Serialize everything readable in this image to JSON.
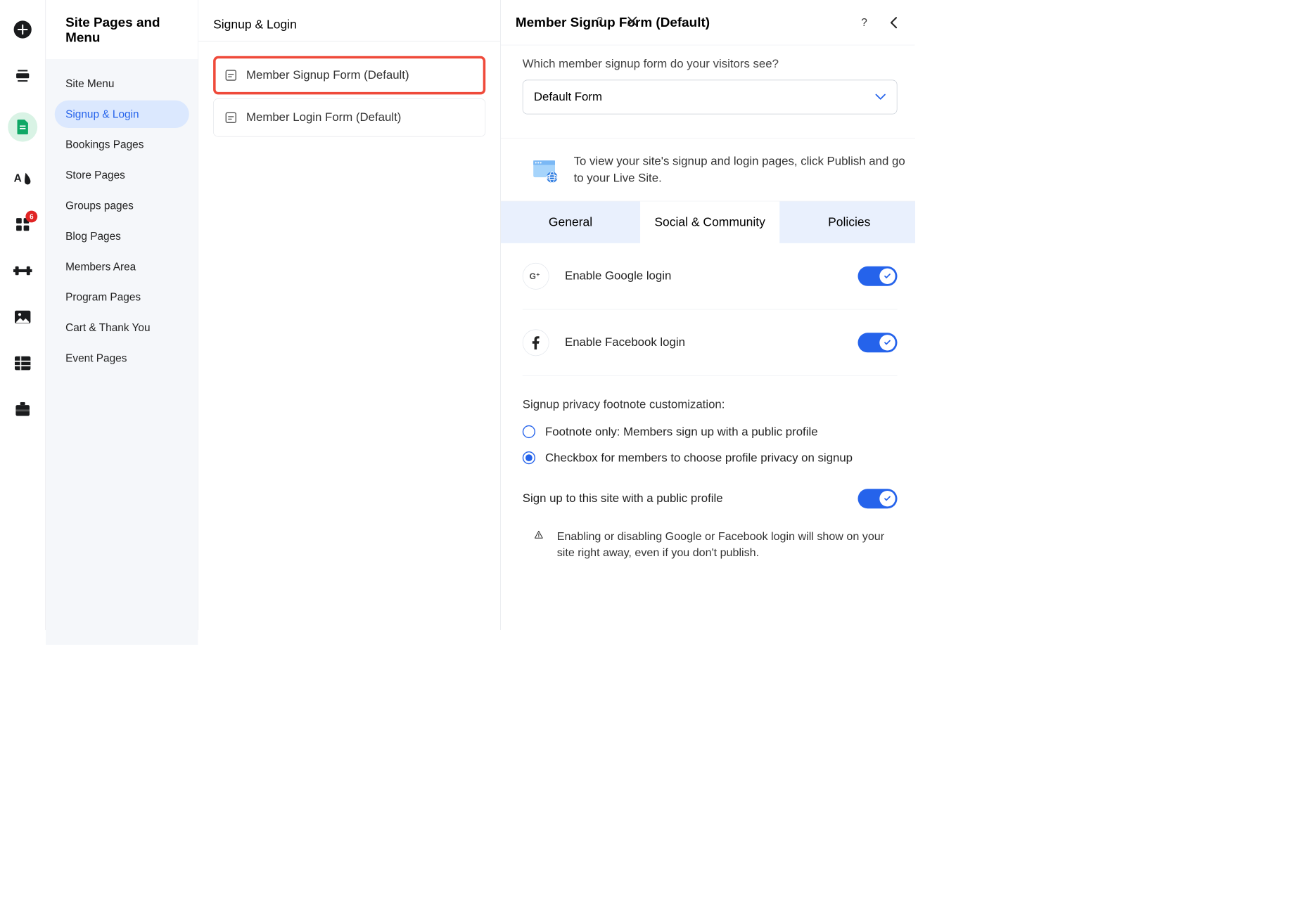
{
  "header": {
    "title": "Site Pages and Menu"
  },
  "rail": {
    "badge": "6"
  },
  "nav": {
    "items": [
      "Site Menu",
      "Signup & Login",
      "Bookings Pages",
      "Store Pages",
      "Groups pages",
      "Blog Pages",
      "Members Area",
      "Program Pages",
      "Cart & Thank You",
      "Event Pages"
    ]
  },
  "panel2": {
    "title": "Signup & Login",
    "items": [
      "Member Signup Form (Default)",
      "Member Login Form (Default)"
    ]
  },
  "panel3": {
    "title": "Member Signup Form (Default)",
    "prompt": "Which member signup form do your visitors see?",
    "selectValue": "Default Form",
    "infoText": "To view your site's signup and login pages, click Publish and go to your Live Site.",
    "tabs": [
      "General",
      "Social & Community",
      "Policies"
    ],
    "googleLabel": "Enable Google login",
    "facebookLabel": "Enable Facebook login",
    "privacyTitle": "Signup privacy footnote customization:",
    "radio1": "Footnote only: Members sign up with a public profile",
    "radio2": "Checkbox for members to choose profile privacy on signup",
    "publicProfileLabel": "Sign up to this site with a public profile",
    "warning": "Enabling or disabling Google or Facebook login will show on your site right away, even if you don't publish."
  }
}
